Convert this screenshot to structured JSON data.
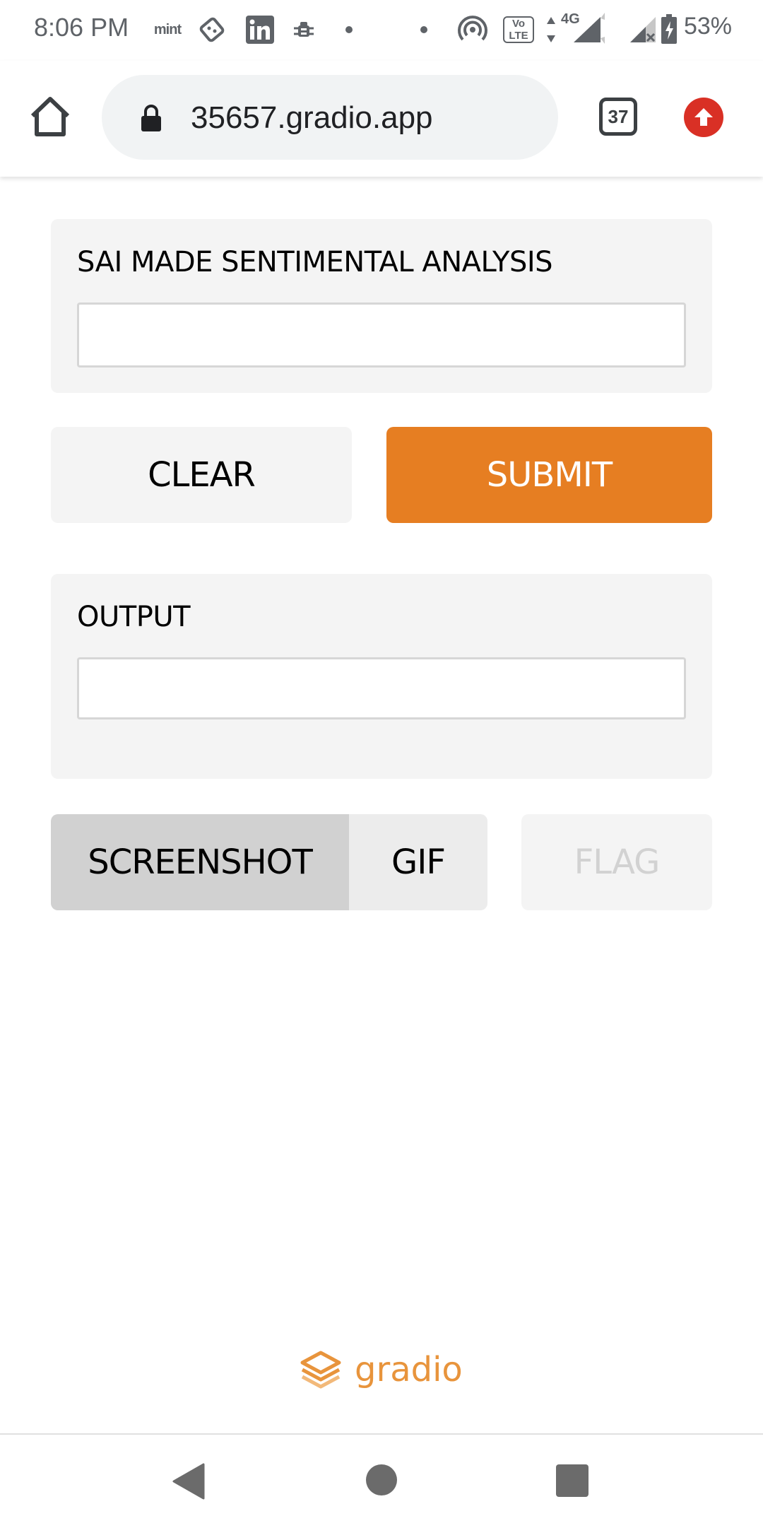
{
  "status_bar": {
    "time": "8:06 PM",
    "icons": [
      "mint-icon",
      "domino-icon",
      "linkedin-icon",
      "bug-icon",
      "dot-icon",
      "dot-icon",
      "hotspot-icon",
      "volte-icon",
      "data-arrows-icon",
      "signal-icon",
      "signal-no-sim-icon",
      "battery-icon"
    ],
    "mint_text": "mint",
    "network_label": "4G",
    "volte_label": "Vo LTE",
    "battery": "53%"
  },
  "browser": {
    "url": "35657.gradio.app",
    "tab_count": "37",
    "home_icon": "home-icon",
    "lock_icon": "lock-icon",
    "update_icon": "update-arrow-icon",
    "update_color": "#d93025"
  },
  "app": {
    "input_label": "SAI MADE SENTIMENTAL ANALYSIS",
    "input_value": "",
    "clear_label": "CLEAR",
    "submit_label": "SUBMIT",
    "submit_color": "#e67e22",
    "output_label": "OUTPUT",
    "output_value": "",
    "screenshot_label": "SCREENSHOT",
    "gif_label": "GIF",
    "flag_label": "FLAG"
  },
  "footer": {
    "logo_text": "gradio",
    "logo_color": "#e8943c"
  },
  "nav": {
    "back_icon": "back-triangle-icon",
    "home_icon": "home-circle-icon",
    "recents_icon": "recents-square-icon"
  }
}
